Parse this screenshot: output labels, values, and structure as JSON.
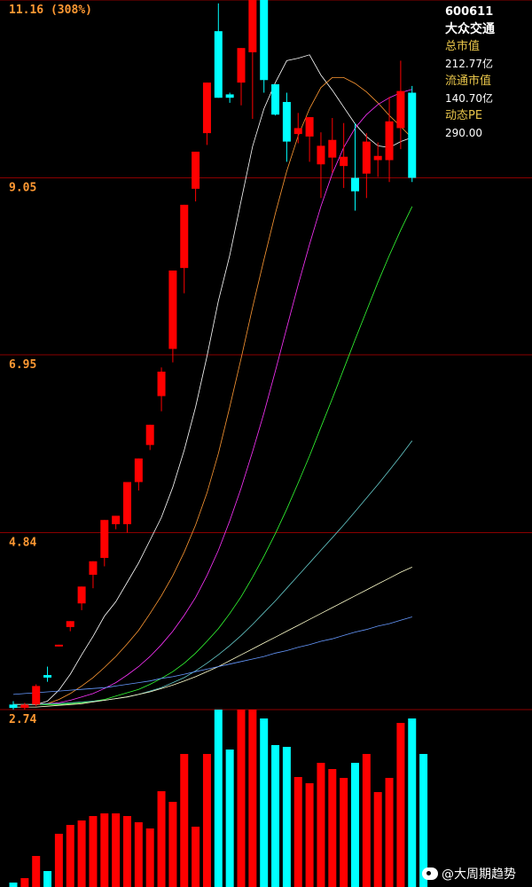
{
  "stock": {
    "code": "600611",
    "name": "大众交通",
    "total_mcap_label": "总市值",
    "total_mcap_value": "212.77亿",
    "float_mcap_label": "流通市值",
    "float_mcap_value": "140.70亿",
    "pe_label": "动态PE",
    "pe_value": "290.00"
  },
  "watermark": "@大周期趋势",
  "colors": {
    "background": "#000000",
    "up": "#ff0000",
    "down": "#00ffff",
    "price_label": "#ff9933",
    "gridline": "#8b0000",
    "ma_series": [
      "#ffffff",
      "#ff9933",
      "#ff33ff",
      "#33ff33",
      "#66cccc",
      "#ffffcc",
      "#6699ff"
    ]
  },
  "chart_data": {
    "type": "candlestick",
    "price_labels": [
      "11.16 (308%)",
      "9.05",
      "6.95",
      "4.84",
      "2.74"
    ],
    "y_ticks": [
      11.16,
      9.05,
      6.95,
      4.84,
      2.74
    ],
    "ylim": [
      2.74,
      11.16
    ],
    "candles": [
      {
        "o": 2.8,
        "h": 2.84,
        "l": 2.74,
        "c": 2.76
      },
      {
        "o": 2.76,
        "h": 2.82,
        "l": 2.74,
        "c": 2.8
      },
      {
        "o": 2.8,
        "h": 3.04,
        "l": 2.78,
        "c": 3.02
      },
      {
        "o": 3.15,
        "h": 3.25,
        "l": 3.07,
        "c": 3.12
      },
      {
        "o": 3.5,
        "h": 3.51,
        "l": 3.49,
        "c": 3.51
      },
      {
        "o": 3.72,
        "h": 3.77,
        "l": 3.67,
        "c": 3.79
      },
      {
        "o": 4.0,
        "h": 4.12,
        "l": 3.92,
        "c": 4.2
      },
      {
        "o": 4.34,
        "h": 4.44,
        "l": 4.18,
        "c": 4.5
      },
      {
        "o": 4.54,
        "h": 4.72,
        "l": 4.44,
        "c": 4.99
      },
      {
        "o": 4.94,
        "h": 5.04,
        "l": 4.88,
        "c": 5.04
      },
      {
        "o": 4.94,
        "h": 5.16,
        "l": 4.84,
        "c": 5.44
      },
      {
        "o": 5.44,
        "h": 5.5,
        "l": 5.34,
        "c": 5.72
      },
      {
        "o": 5.88,
        "h": 6.03,
        "l": 5.82,
        "c": 6.12
      },
      {
        "o": 6.46,
        "h": 6.8,
        "l": 6.28,
        "c": 6.75
      },
      {
        "o": 7.02,
        "h": 7.72,
        "l": 6.86,
        "c": 7.95
      },
      {
        "o": 7.98,
        "h": 8.04,
        "l": 7.68,
        "c": 8.73
      },
      {
        "o": 8.92,
        "h": 9.11,
        "l": 8.77,
        "c": 9.36
      },
      {
        "o": 9.58,
        "h": 9.82,
        "l": 9.44,
        "c": 10.18
      },
      {
        "o": 10.79,
        "h": 11.12,
        "l": 10.18,
        "c": 10.0
      },
      {
        "o": 10.04,
        "h": 10.06,
        "l": 9.94,
        "c": 10.0
      },
      {
        "o": 10.18,
        "h": 10.59,
        "l": 9.91,
        "c": 10.59
      },
      {
        "o": 10.54,
        "h": 11.78,
        "l": 9.75,
        "c": 11.16
      },
      {
        "o": 11.16,
        "h": 10.96,
        "l": 10.06,
        "c": 10.21
      },
      {
        "o": 10.16,
        "h": 10.04,
        "l": 9.79,
        "c": 9.8
      },
      {
        "o": 9.95,
        "h": 10.06,
        "l": 9.24,
        "c": 9.48
      },
      {
        "o": 9.57,
        "h": 9.82,
        "l": 9.46,
        "c": 9.64
      },
      {
        "o": 9.54,
        "h": 9.72,
        "l": 9.24,
        "c": 9.77
      },
      {
        "o": 9.21,
        "h": 9.59,
        "l": 8.81,
        "c": 9.43
      },
      {
        "o": 9.29,
        "h": 9.76,
        "l": 9.11,
        "c": 9.5
      },
      {
        "o": 9.19,
        "h": 9.7,
        "l": 8.93,
        "c": 9.3
      },
      {
        "o": 9.05,
        "h": 9.7,
        "l": 8.66,
        "c": 8.89
      },
      {
        "o": 9.1,
        "h": 9.58,
        "l": 8.81,
        "c": 9.48
      },
      {
        "o": 9.26,
        "h": 9.47,
        "l": 9.06,
        "c": 9.31
      },
      {
        "o": 9.26,
        "h": 10.01,
        "l": 9.0,
        "c": 9.72
      },
      {
        "o": 9.64,
        "h": 10.44,
        "l": 9.39,
        "c": 10.08
      },
      {
        "o": 10.06,
        "h": 10.14,
        "l": 9.0,
        "c": 9.05
      }
    ],
    "volumes": [
      5,
      10,
      35,
      18,
      60,
      70,
      75,
      80,
      83,
      83,
      80,
      73,
      66,
      108,
      96,
      150,
      68,
      150,
      200,
      155,
      200,
      200,
      190,
      160,
      158,
      124,
      117,
      140,
      133,
      123,
      140,
      150,
      107,
      123,
      185,
      190,
      150
    ],
    "volume_ylim": [
      0,
      200
    ],
    "ma_series": [
      [
        2.8,
        2.8,
        2.8,
        2.84,
        2.97,
        3.16,
        3.39,
        3.61,
        3.85,
        4.02,
        4.25,
        4.48,
        4.75,
        5.02,
        5.38,
        5.82,
        6.33,
        6.93,
        7.59,
        8.13,
        8.78,
        9.42,
        9.87,
        10.18,
        10.44,
        10.47,
        10.51,
        10.27,
        10.09,
        9.89,
        9.69,
        9.54,
        9.43,
        9.41,
        9.48,
        9.53
      ],
      [
        2.8,
        2.8,
        2.8,
        2.81,
        2.86,
        2.93,
        3.02,
        3.12,
        3.24,
        3.37,
        3.52,
        3.68,
        3.88,
        4.09,
        4.33,
        4.61,
        4.93,
        5.31,
        5.78,
        6.33,
        6.91,
        7.51,
        8.08,
        8.63,
        9.13,
        9.55,
        9.87,
        10.12,
        10.24,
        10.24,
        10.17,
        10.07,
        9.94,
        9.79,
        9.66,
        9.52
      ],
      [
        2.8,
        2.8,
        2.8,
        2.81,
        2.82,
        2.85,
        2.89,
        2.93,
        2.99,
        3.06,
        3.15,
        3.25,
        3.37,
        3.51,
        3.67,
        3.86,
        4.07,
        4.33,
        4.63,
        4.98,
        5.37,
        5.8,
        6.26,
        6.76,
        7.27,
        7.78,
        8.26,
        8.71,
        9.1,
        9.41,
        9.64,
        9.8,
        9.92,
        10.0,
        10.06,
        10.1
      ],
      [
        2.8,
        2.8,
        2.8,
        2.8,
        2.8,
        2.81,
        2.82,
        2.84,
        2.86,
        2.9,
        2.94,
        2.98,
        3.04,
        3.11,
        3.19,
        3.29,
        3.41,
        3.55,
        3.7,
        3.88,
        4.08,
        4.31,
        4.56,
        4.83,
        5.12,
        5.43,
        5.75,
        6.09,
        6.43,
        6.78,
        7.13,
        7.47,
        7.81,
        8.13,
        8.43,
        8.71
      ],
      [
        2.8,
        2.8,
        2.8,
        2.81,
        2.81,
        2.82,
        2.83,
        2.84,
        2.85,
        2.87,
        2.89,
        2.92,
        2.96,
        3.0,
        3.06,
        3.12,
        3.2,
        3.29,
        3.39,
        3.5,
        3.62,
        3.75,
        3.89,
        4.03,
        4.18,
        4.33,
        4.48,
        4.63,
        4.78,
        4.93,
        5.09,
        5.25,
        5.41,
        5.58,
        5.75,
        5.93
      ],
      [
        2.77,
        2.77,
        2.77,
        2.78,
        2.79,
        2.8,
        2.81,
        2.83,
        2.85,
        2.87,
        2.89,
        2.92,
        2.95,
        2.99,
        3.03,
        3.08,
        3.13,
        3.19,
        3.25,
        3.32,
        3.39,
        3.46,
        3.53,
        3.6,
        3.67,
        3.74,
        3.81,
        3.88,
        3.95,
        4.02,
        4.09,
        4.16,
        4.23,
        4.3,
        4.37,
        4.43
      ],
      [
        2.92,
        2.93,
        2.94,
        2.95,
        2.96,
        2.97,
        2.98,
        2.99,
        3.0,
        3.02,
        3.04,
        3.06,
        3.08,
        3.11,
        3.13,
        3.16,
        3.19,
        3.22,
        3.25,
        3.28,
        3.31,
        3.34,
        3.37,
        3.41,
        3.44,
        3.48,
        3.51,
        3.55,
        3.58,
        3.62,
        3.66,
        3.69,
        3.73,
        3.76,
        3.8,
        3.84
      ]
    ]
  }
}
